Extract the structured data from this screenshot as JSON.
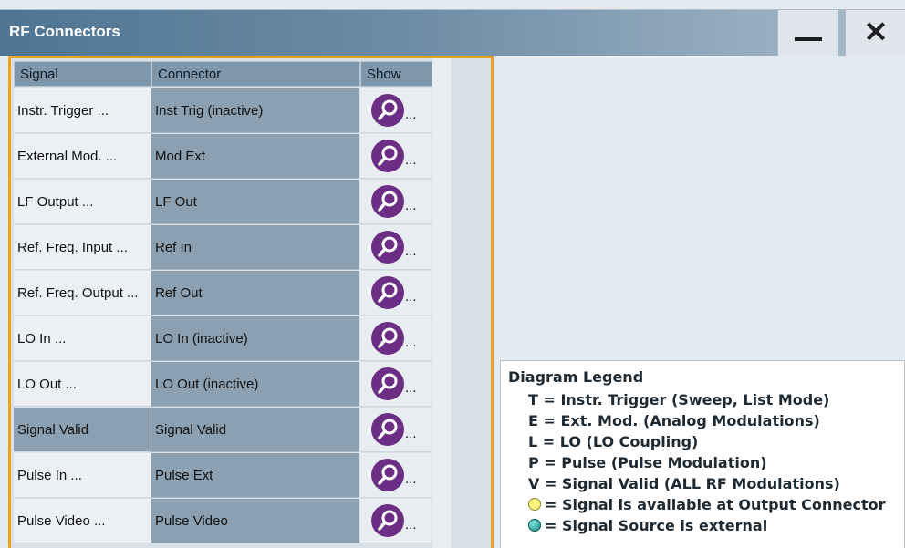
{
  "window": {
    "title": "RF Connectors",
    "minimize_glyph": "—",
    "close_glyph": "✕"
  },
  "table": {
    "headers": {
      "signal": "Signal",
      "connector": "Connector",
      "show": "Show"
    },
    "rows": [
      {
        "signal": "Instr. Trigger ...",
        "connector": "Inst Trig (inactive)"
      },
      {
        "signal": "External Mod. ...",
        "connector": "Mod Ext"
      },
      {
        "signal": "LF Output ...",
        "connector": "LF Out"
      },
      {
        "signal": "Ref. Freq. Input ...",
        "connector": "Ref In"
      },
      {
        "signal": "Ref. Freq. Output ...",
        "connector": "Ref Out"
      },
      {
        "signal": "LO In ...",
        "connector": "LO In (inactive)"
      },
      {
        "signal": "LO Out ...",
        "connector": "LO Out (inactive)"
      },
      {
        "signal": "Signal Valid",
        "connector": "Signal Valid"
      },
      {
        "signal": "Pulse In ...",
        "connector": "Pulse Ext"
      },
      {
        "signal": "Pulse Video ...",
        "connector": "Pulse Video"
      }
    ],
    "show_dots": "...",
    "show_icon": "magnifier-icon",
    "selected_row_index": 7
  },
  "legend": {
    "title": "Diagram Legend",
    "lines": [
      "T = Instr. Trigger (Sweep, List Mode)",
      "E = Ext. Mod. (Analog Modulations)",
      "L = LO (LO Coupling)",
      "P = Pulse (Pulse Modulation)",
      "V = Signal Valid (ALL RF Modulations)"
    ],
    "available_text": "= Signal is available at Output Connector",
    "external_text": "= Signal Source is external"
  },
  "colors": {
    "accent_border": "#f0a11c",
    "show_button": "#6b2e84",
    "titlebar": "#4f7593"
  }
}
